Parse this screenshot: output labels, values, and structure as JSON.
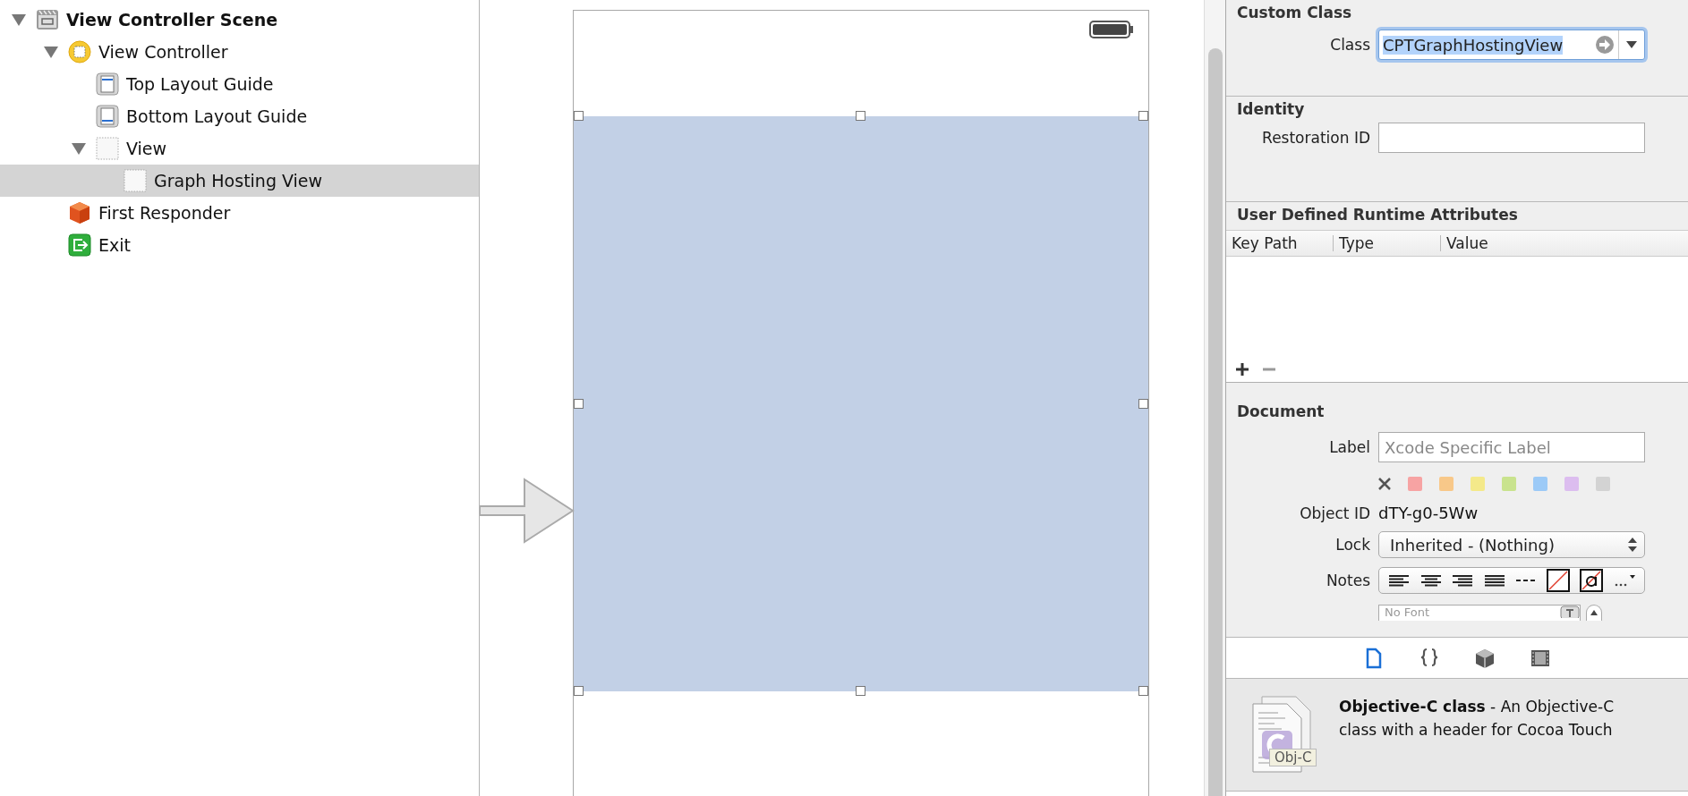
{
  "outline": {
    "items": [
      {
        "label": "View Controller Scene",
        "kind": "scene",
        "expanded": true,
        "selected": false,
        "children": [
          {
            "label": "View Controller",
            "kind": "controller",
            "expanded": true,
            "selected": false,
            "children": [
              {
                "label": "Top Layout Guide",
                "kind": "top-guide",
                "selected": false
              },
              {
                "label": "Bottom Layout Guide",
                "kind": "bottom-guide",
                "selected": false
              },
              {
                "label": "View",
                "kind": "view",
                "expanded": true,
                "selected": false,
                "children": [
                  {
                    "label": "Graph Hosting View",
                    "kind": "view",
                    "selected": true
                  }
                ]
              }
            ]
          },
          {
            "label": "First Responder",
            "kind": "responder",
            "selected": false
          },
          {
            "label": "Exit",
            "kind": "exit",
            "selected": false
          }
        ]
      }
    ]
  },
  "inspector": {
    "custom_class": {
      "title": "Custom Class",
      "class_label": "Class",
      "class_value": "CPTGraphHostingView",
      "class_selected": true
    },
    "identity": {
      "title": "Identity",
      "restoration_label": "Restoration ID"
    },
    "runtime_attributes": {
      "title": "User Defined Runtime Attributes",
      "columns": [
        "Key Path",
        "Type",
        "Value"
      ]
    },
    "document": {
      "title": "Document",
      "label_label": "Label",
      "label_placeholder": "Xcode Specific Label",
      "color_labels": [
        {
          "color": "#f7a3a3"
        },
        {
          "color": "#f8c889"
        },
        {
          "color": "#f4e98a"
        },
        {
          "color": "#c9e38e"
        },
        {
          "color": "#9ccaf7"
        },
        {
          "color": "#dcbdef"
        },
        {
          "color": "#d3d3d3"
        }
      ],
      "object_id_label": "Object ID",
      "object_id": "dTY-g0-5Ww",
      "lock_label": "Lock",
      "lock_value": "Inherited - (Nothing)",
      "notes_label": "Notes",
      "font_placeholder": "No Font"
    }
  },
  "library": {
    "tabs": [
      {
        "kind": "file",
        "selected": true
      },
      {
        "kind": "braces",
        "selected": false
      },
      {
        "kind": "cube",
        "selected": false
      },
      {
        "kind": "film",
        "selected": false
      }
    ],
    "items": [
      {
        "text": "**Objective-C class** - An Objective-C class with a header for Cocoa Touch",
        "badge": "Obj-C"
      }
    ]
  }
}
